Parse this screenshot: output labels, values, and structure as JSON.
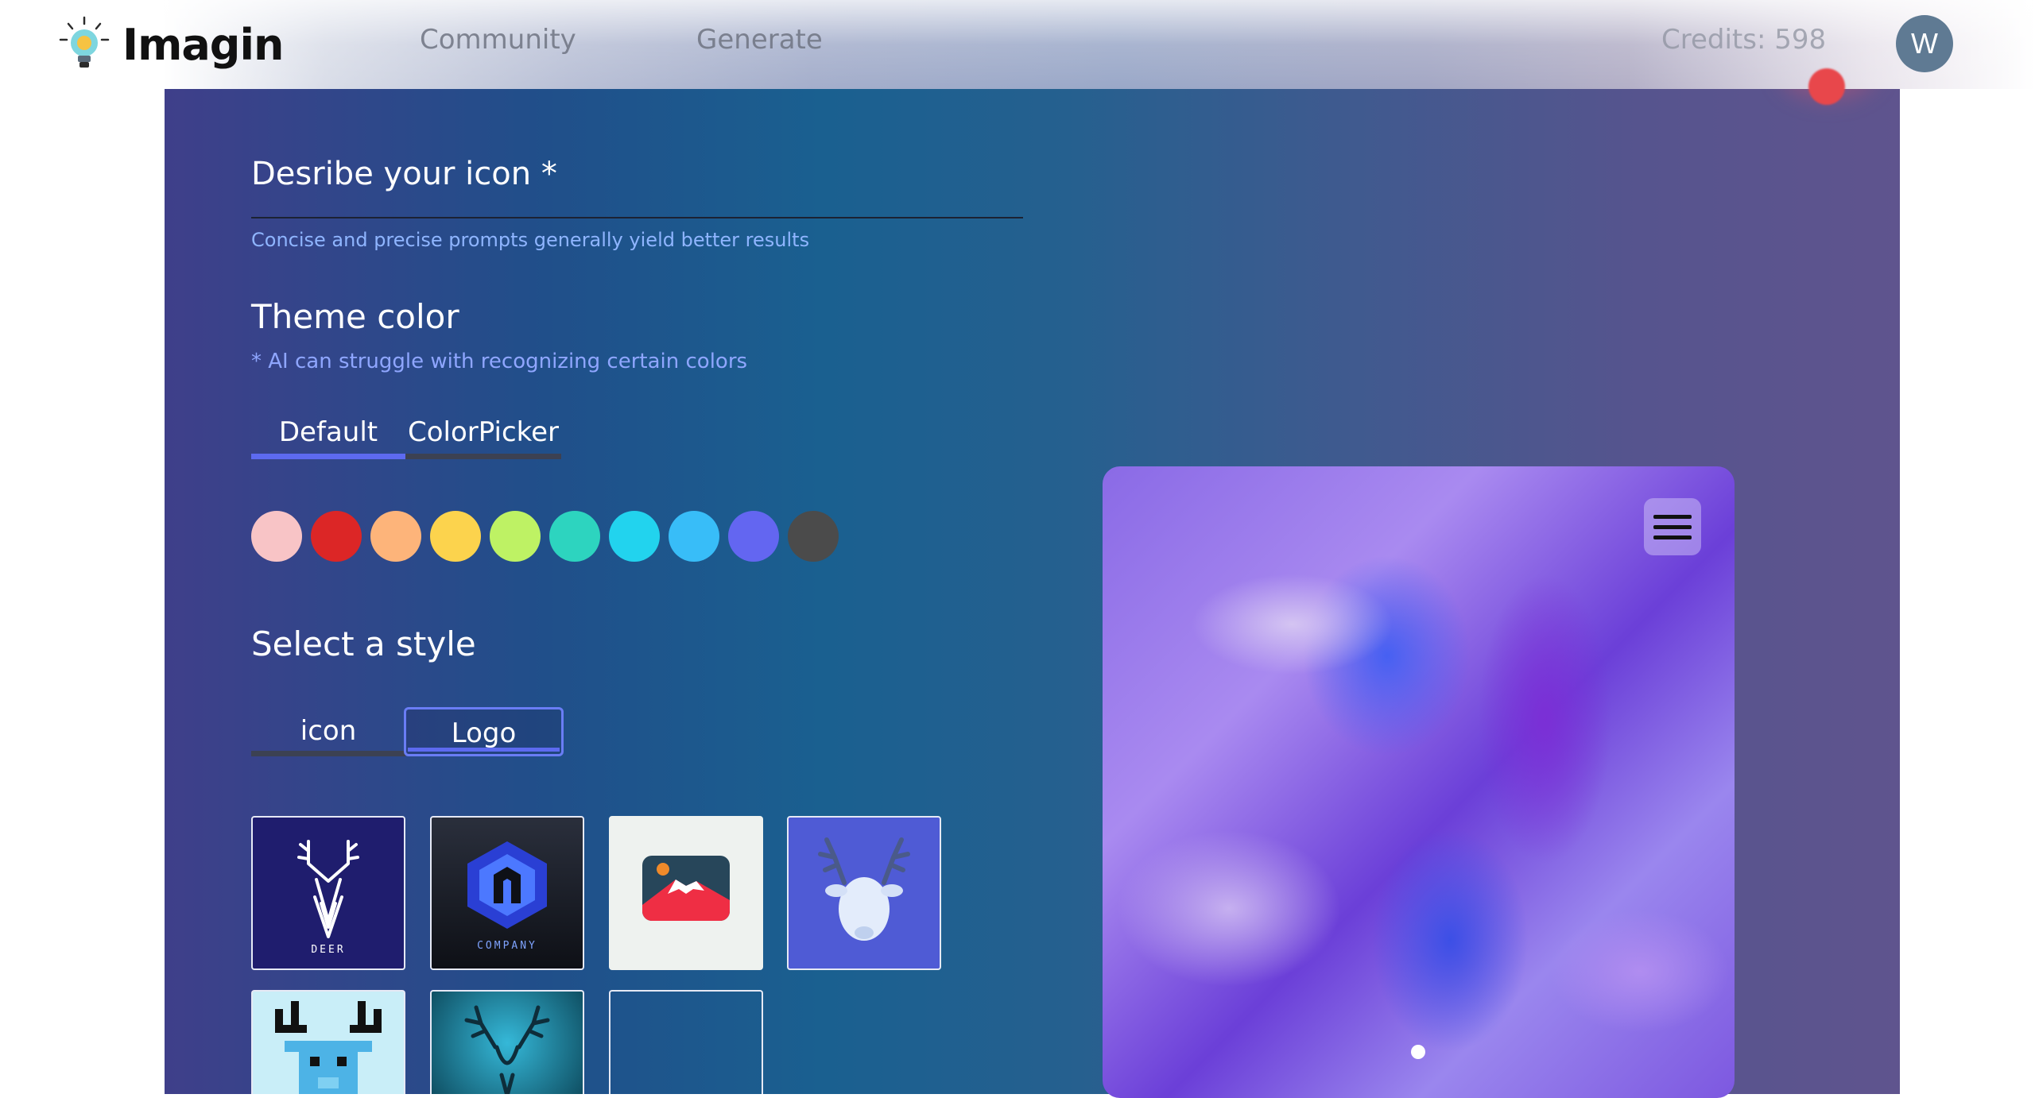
{
  "app": {
    "name": "Imagin"
  },
  "nav": {
    "community": "Community",
    "generate": "Generate"
  },
  "header": {
    "credits": "Credits: 598",
    "avatar_initial": "W"
  },
  "form": {
    "describe_label": "Desribe your icon *",
    "describe_helper": "Concise and precise prompts generally yield better results",
    "theme_title": "Theme color",
    "theme_note": "* AI can struggle with recognizing certain colors",
    "color_tabs": [
      "Default",
      "ColorPicker"
    ],
    "active_color_tab": "Default",
    "swatches": [
      "#f8c4c6",
      "#dc2626",
      "#fdb47a",
      "#fcd34d",
      "#bef264",
      "#2dd4bf",
      "#22d3ee",
      "#38bdf8",
      "#6366f1",
      "#4b4b4b"
    ],
    "style_title": "Select a style",
    "style_tabs": [
      "icon",
      "Logo"
    ],
    "selected_style": "Logo",
    "thumbnails": [
      {
        "name": "deer-logo-thumb",
        "caption": "DEER"
      },
      {
        "name": "company-logo-thumb",
        "caption": "COMPANY"
      },
      {
        "name": "mountain-logo-thumb",
        "caption": ""
      },
      {
        "name": "deer-3d-thumb",
        "caption": ""
      },
      {
        "name": "pixel-deer-thumb",
        "caption": ""
      },
      {
        "name": "deer-silhouette-thumb",
        "caption": ""
      },
      {
        "name": "empty-thumb",
        "caption": ""
      }
    ]
  },
  "preview": {
    "menu_icon": "hamburger-icon",
    "active_slide": 1
  }
}
